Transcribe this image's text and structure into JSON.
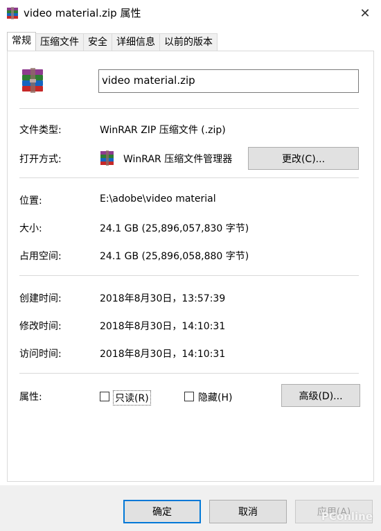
{
  "window": {
    "title": "video material.zip 属性",
    "close_glyph": "✕"
  },
  "tabs": [
    {
      "label": "常规"
    },
    {
      "label": "压缩文件"
    },
    {
      "label": "安全"
    },
    {
      "label": "详细信息"
    },
    {
      "label": "以前的版本"
    }
  ],
  "general": {
    "filename": "video material.zip",
    "file_type_label": "文件类型:",
    "file_type_value": "WinRAR ZIP 压缩文件 (.zip)",
    "opens_with_label": "打开方式:",
    "opens_with_value": "WinRAR 压缩文件管理器",
    "change_button": "更改(C)...",
    "location_label": "位置:",
    "location_value": "E:\\adobe\\video material",
    "size_label": "大小:",
    "size_value": "24.1 GB (25,896,057,830 字节)",
    "disk_size_label": "占用空间:",
    "disk_size_value": "24.1 GB (25,896,058,880 字节)",
    "created_label": "创建时间:",
    "created_value": "2018年8月30日，13:57:39",
    "modified_label": "修改时间:",
    "modified_value": "2018年8月30日，14:10:31",
    "accessed_label": "访问时间:",
    "accessed_value": "2018年8月30日，14:10:31",
    "attributes_label": "属性:",
    "readonly_label": "只读(R)",
    "hidden_label": "隐藏(H)",
    "advanced_button": "高级(D)..."
  },
  "footer": {
    "ok": "确定",
    "cancel": "取消",
    "apply": "应用(A)"
  },
  "watermark": "PConline"
}
